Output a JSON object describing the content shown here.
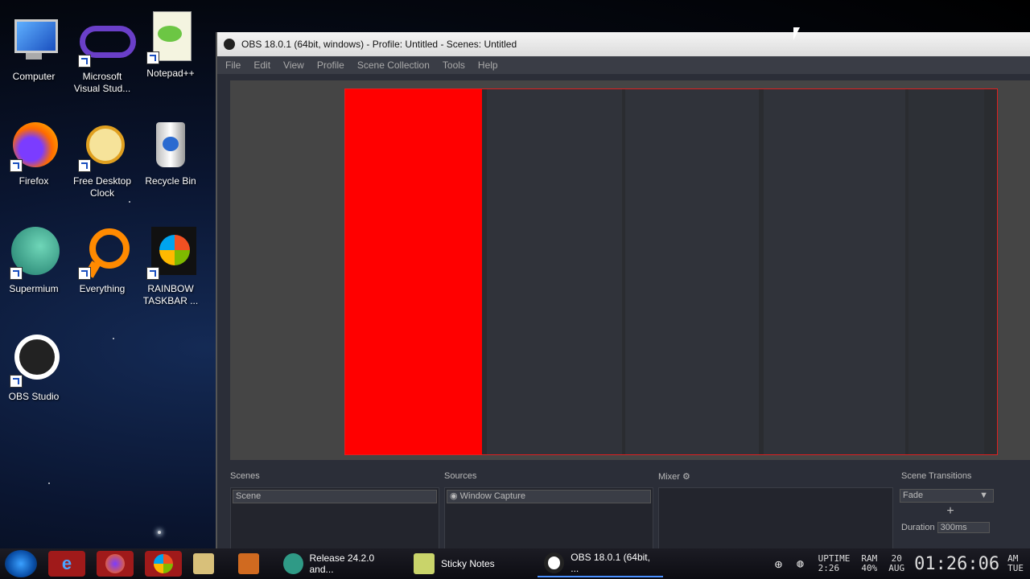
{
  "desktop": {
    "icons": [
      {
        "label": "Computer",
        "icon": "computer-icon"
      },
      {
        "label": "Microsoft Visual Stud...",
        "icon": "visual-studio-icon"
      },
      {
        "label": "Notepad++",
        "icon": "notepadpp-icon"
      },
      {
        "label": "Firefox",
        "icon": "firefox-icon"
      },
      {
        "label": "Free Desktop Clock",
        "icon": "clock-icon"
      },
      {
        "label": "Recycle Bin",
        "icon": "recycle-bin-icon"
      },
      {
        "label": "Supermium",
        "icon": "supermium-icon"
      },
      {
        "label": "Everything",
        "icon": "everything-icon"
      },
      {
        "label": "RAINBOW TASKBAR ...",
        "icon": "rainbow-taskbar-icon"
      },
      {
        "label": "OBS Studio",
        "icon": "obs-icon"
      }
    ]
  },
  "obs": {
    "title": "OBS 18.0.1 (64bit, windows) - Profile: Untitled - Scenes: Untitled",
    "menu": [
      "File",
      "Edit",
      "View",
      "Profile",
      "Scene Collection",
      "Tools",
      "Help"
    ],
    "docks": {
      "scenes_title": "Scenes",
      "scene_item": "Scene",
      "sources_title": "Sources",
      "source_item": "Window Capture",
      "mixer_title": "Mixer",
      "transitions_title": "Scene Transitions",
      "transition_select": "Fade",
      "duration_label": "Duration",
      "duration_value": "300ms"
    }
  },
  "taskbar": {
    "buttons": [
      {
        "label": "Release 24.2.0 and..."
      },
      {
        "label": "Sticky Notes"
      },
      {
        "label": "OBS 18.0.1 (64bit, ..."
      }
    ],
    "clock": {
      "uptime_label": "UPTIME",
      "uptime_value": "2:26",
      "ram_label": "RAM",
      "ram_value": "40%",
      "date_day": "20",
      "date_month": "AUG",
      "time": "01:26:06",
      "ampm": "AM",
      "weekday": "TUE"
    }
  },
  "colors": {
    "accent_red": "#ff0000",
    "obs_bg": "#2b2e38"
  }
}
